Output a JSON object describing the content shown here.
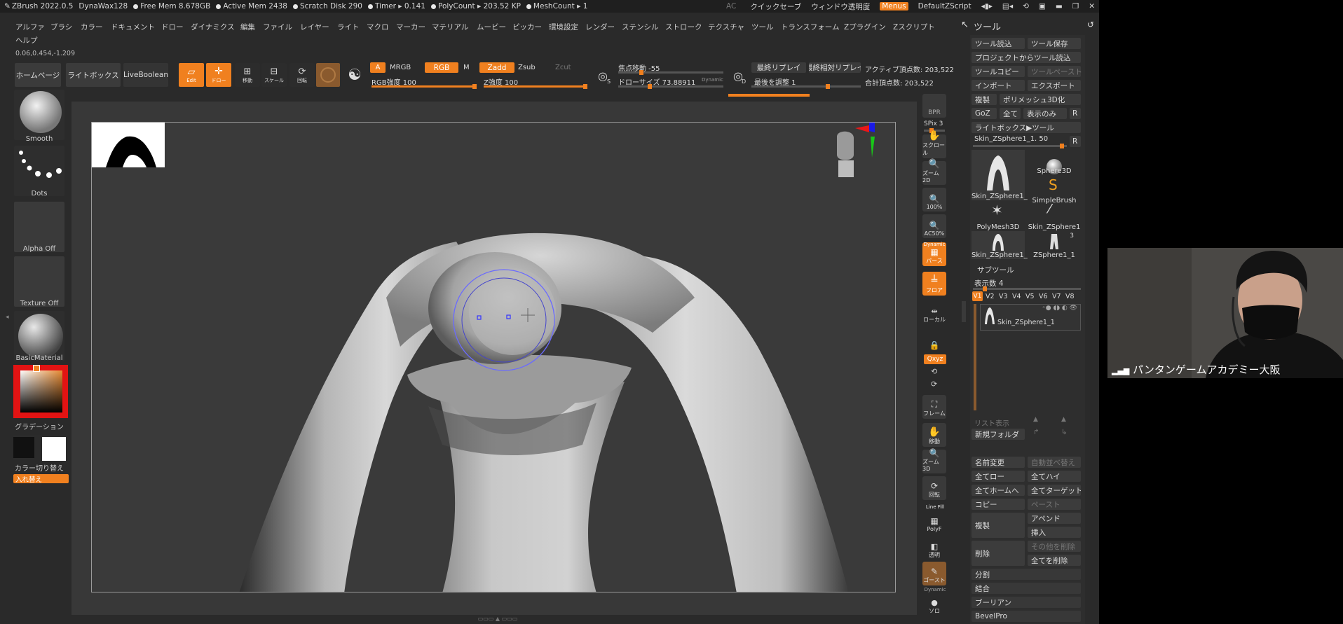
{
  "titlebar": {
    "app": "ZBrush 2022.0.5",
    "brush": "DynaWax128",
    "free_mem": "Free Mem 8.678GB",
    "active_mem": "Active Mem 2438",
    "scratch": "Scratch Disk 290",
    "timer": "Timer ▸ 0.141",
    "polycount": "PolyCount ▸ 203.52 KP",
    "meshcount": "MeshCount ▸ 1",
    "ac": "AC",
    "quicksave": "クイックセーブ",
    "window_transparency": "ウィンドウ透明度",
    "menus": "Menus",
    "script": "DefaultZScript"
  },
  "menubar": {
    "items": [
      "アルファ",
      "ブラシ",
      "カラー",
      "ドキュメント",
      "ドロー",
      "ダイナミクス",
      "編集",
      "ファイル",
      "レイヤー",
      "ライト",
      "マクロ",
      "マーカー",
      "マテリアル",
      "ムービー",
      "ピッカー",
      "環境設定",
      "レンダー",
      "ステンシル",
      "ストローク",
      "テクスチャ",
      "ツール",
      "トランスフォーム",
      "Zプラグイン",
      "Zスクリプト"
    ],
    "help": "ヘルプ",
    "coords": "0.06,0.454,-1.209"
  },
  "palette_title": "ツール",
  "shelf": {
    "home": "ホームページ",
    "lightbox": "ライトボックス",
    "liveboolean": "LiveBoolean",
    "edit": "Edit",
    "draw": "ドロー",
    "move": "移動",
    "scale": "スケール",
    "rotate": "回転",
    "a": "A",
    "mrgb": "MRGB",
    "rgb": "RGB",
    "m": "M",
    "zadd": "Zadd",
    "zsub": "Zsub",
    "zcut": "Zcut",
    "rgb_intensity": "RGB強度 100",
    "z_intensity": "Z強度 100",
    "focal_shift": "焦点移動 -55",
    "draw_size": "ドローサイズ 73.88911",
    "dynamic": "Dynamic",
    "last_replay": "最終リプレイ",
    "last_rel_replay": "最終相対リプレイ",
    "adjust_last": "最後を調整 1",
    "active_points": "アクティブ頂点数: 203,522",
    "total_points": "合計頂点数: 203,522",
    "s_label": "S",
    "d_label": "D"
  },
  "leftshelf": {
    "brush": "Smooth",
    "stroke": "Dots",
    "alpha": "Alpha Off",
    "texture": "Texture Off",
    "material": "BasicMaterial",
    "gradient": "グラデーション",
    "switch_color": "カラー切り替え",
    "swap": "入れ替え"
  },
  "rshelf": {
    "bpr": "BPR",
    "spix": "SPix 3",
    "scroll": "スクロール",
    "zoom2d": "ズーム2D",
    "pct100": "100%",
    "ac50": "AC50%",
    "dynamic": "Dynamic",
    "persp": "パース",
    "floor": "フロア",
    "local": "ローカル",
    "lsym": "L.Sym",
    "xyz": "Qxyz",
    "frame": "フレーム",
    "move": "移動",
    "zoom3d": "ズーム3D",
    "rotate": "回転",
    "linefill": "Line Fill",
    "polyf": "PolyF",
    "transp": "透明",
    "ghost": "ゴースト",
    "solo": "ソロ"
  },
  "palette": {
    "load_tool": "ツール読込",
    "save_tool": "ツール保存",
    "load_from_project": "プロジェクトからツール読込",
    "copy_tool": "ツールコピー",
    "paste_tool": "ツールペースト",
    "import": "インポート",
    "export": "エクスポート",
    "clone": "複製",
    "make_polymesh": "ポリメッシュ3D化",
    "goz": "GoZ",
    "all": "全て",
    "visible": "表示のみ",
    "r": "R",
    "lightbox_tools": "ライトボックス▶ツール",
    "current_tool": "Skin_ZSphere1_1. 50",
    "tools": [
      "Skin_ZSphere1_",
      "Sphere3D",
      "SimpleBrush",
      "PolyMesh3D",
      "Skin_ZSphere1",
      "Skin_ZSphere1_",
      "ZSphere1_1"
    ],
    "tool_count": "3",
    "subtool_title": "サブツール",
    "visible_count": "表示数 4",
    "versions": [
      "V1",
      "V2",
      "V3",
      "V4",
      "V5",
      "V6",
      "V7",
      "V8"
    ],
    "subtool_name": "Skin_ZSphere1_1",
    "list_all": "リスト表示",
    "new_folder": "新規フォルダ",
    "rename": "名前変更",
    "auto_reorder": "自動並べ替え",
    "all_low": "全てロー",
    "all_high": "全てハイ",
    "all_to_home": "全てホームへ",
    "all_to_target": "全てターゲット",
    "copy": "コピー",
    "paste": "ペースト",
    "duplicate": "複製",
    "append": "アペンド",
    "insert": "挿入",
    "delete": "削除",
    "del_other": "その他を削除",
    "del_all": "全てを削除",
    "split": "分割",
    "merge": "結合",
    "boolean": "ブーリアン",
    "bevelpro": "BevelPro"
  },
  "webcam": {
    "label": "パンタンゲームアカデミー大阪"
  }
}
